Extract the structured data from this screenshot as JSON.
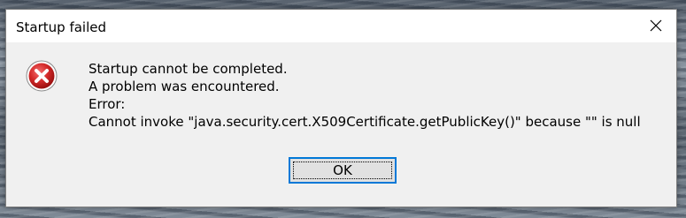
{
  "dialog": {
    "title": "Startup failed",
    "icon": "error-icon",
    "messages": [
      "Startup cannot be completed.",
      "A problem was encountered.",
      "Error:",
      "Cannot invoke \"java.security.cert.X509Certificate.getPublicKey()\" because \"\" is null"
    ],
    "ok_label": "OK",
    "close_icon": "close-icon"
  },
  "colors": {
    "error_red": "#cc1f1f",
    "focus_blue": "#0078d7",
    "dialog_bg": "#f0f0f0"
  }
}
